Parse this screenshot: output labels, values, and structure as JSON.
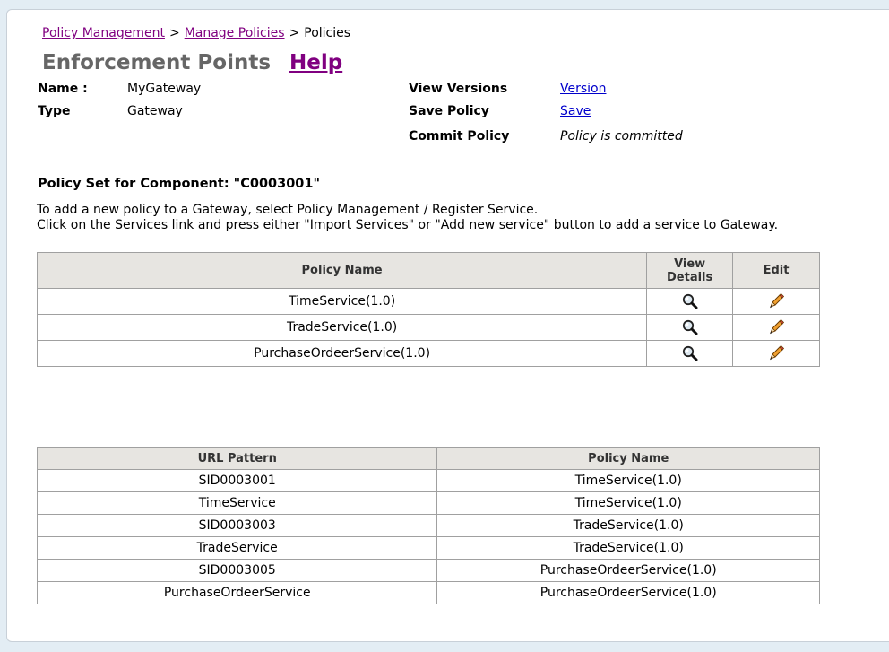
{
  "breadcrumb": {
    "item1": "Policy Management",
    "sep1": ">",
    "item2": "Manage Policies",
    "sep2": ">",
    "current": "Policies"
  },
  "header": {
    "title": "Enforcement Points",
    "help": "Help"
  },
  "details": {
    "name_label": "Name :",
    "name_value": "MyGateway",
    "type_label": "Type",
    "type_value": "Gateway",
    "view_versions_label": "View Versions",
    "view_versions_link": "Version",
    "save_policy_label": "Save Policy",
    "save_policy_link": "Save",
    "commit_policy_label": "Commit Policy",
    "commit_policy_value": "Policy is committed"
  },
  "section": {
    "title": "Policy Set for Component: \"C0003001\"",
    "instruction1": "To add a new policy to a Gateway, select Policy Management / Register Service.",
    "instruction2": "Click on the Services link and press either \"Import Services\" or \"Add new service\" button to add a service to Gateway."
  },
  "policy_table": {
    "headers": {
      "policy_name": "Policy Name",
      "view_details_1": "View",
      "view_details_2": "Details",
      "edit": "Edit"
    },
    "rows": [
      {
        "policy_name": "TimeService(1.0)"
      },
      {
        "policy_name": "TradeService(1.0)"
      },
      {
        "policy_name": "PurchaseOrdeerService(1.0)"
      }
    ],
    "view_icon": "magnifier-icon",
    "edit_icon": "pencil-icon"
  },
  "url_table": {
    "headers": {
      "url_pattern": "URL Pattern",
      "policy_name": "Policy Name"
    },
    "rows": [
      {
        "url_pattern": "SID0003001",
        "policy_name": "TimeService(1.0)"
      },
      {
        "url_pattern": "TimeService",
        "policy_name": "TimeService(1.0)"
      },
      {
        "url_pattern": "SID0003003",
        "policy_name": "TradeService(1.0)"
      },
      {
        "url_pattern": "TradeService",
        "policy_name": "TradeService(1.0)"
      },
      {
        "url_pattern": "SID0003005",
        "policy_name": "PurchaseOrdeerService(1.0)"
      },
      {
        "url_pattern": "PurchaseOrdeerService",
        "policy_name": "PurchaseOrdeerService(1.0)"
      }
    ]
  },
  "colors": {
    "background": "#e3edf4",
    "visited_link": "#800080",
    "link": "#0000cc",
    "table_header": "#e7e5e1"
  }
}
